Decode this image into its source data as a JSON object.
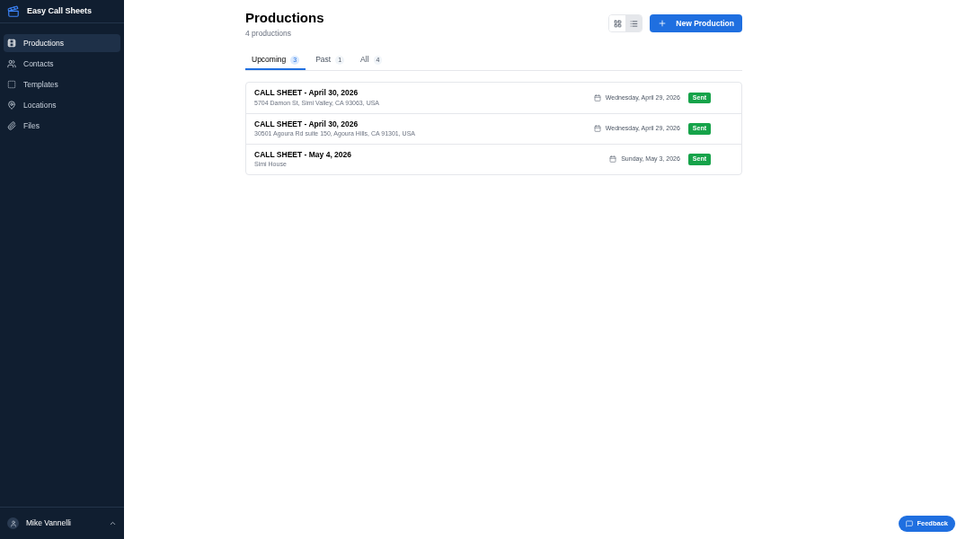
{
  "sidebar": {
    "app_name": "Easy Call Sheets",
    "items": [
      {
        "label": "Productions",
        "selected": true
      },
      {
        "label": "Contacts",
        "selected": false
      },
      {
        "label": "Templates",
        "selected": false
      },
      {
        "label": "Locations",
        "selected": false
      },
      {
        "label": "Files",
        "selected": false
      }
    ],
    "user": {
      "name": "Mike Vannelli"
    }
  },
  "header": {
    "title": "Productions",
    "subtitle": "4 productions",
    "view_toggle": [
      {
        "kind": "grid",
        "selected": false
      },
      {
        "kind": "list",
        "selected": true
      }
    ],
    "new_button": "New Production"
  },
  "tabs": [
    {
      "label": "Upcoming",
      "count": "3",
      "selected": true
    },
    {
      "label": "Past",
      "count": "1",
      "selected": false
    },
    {
      "label": "All",
      "count": "4",
      "selected": false
    }
  ],
  "rows": [
    {
      "title": "CALL SHEET - April 30, 2026",
      "address": "5704 Damon St, Simi Valley, CA 93063, USA",
      "date": "Wednesday, April 29, 2026",
      "status": "Sent"
    },
    {
      "title": "CALL SHEET - April 30, 2026",
      "address": "30501 Agoura Rd suite 150, Agoura Hills, CA 91301, USA",
      "date": "Wednesday, April 29, 2026",
      "status": "Sent"
    },
    {
      "title": "CALL SHEET - May 4, 2026",
      "address": "Simi House",
      "date": "Sunday, May 3, 2026",
      "status": "Sent"
    }
  ],
  "feedback_button": "Feedback"
}
